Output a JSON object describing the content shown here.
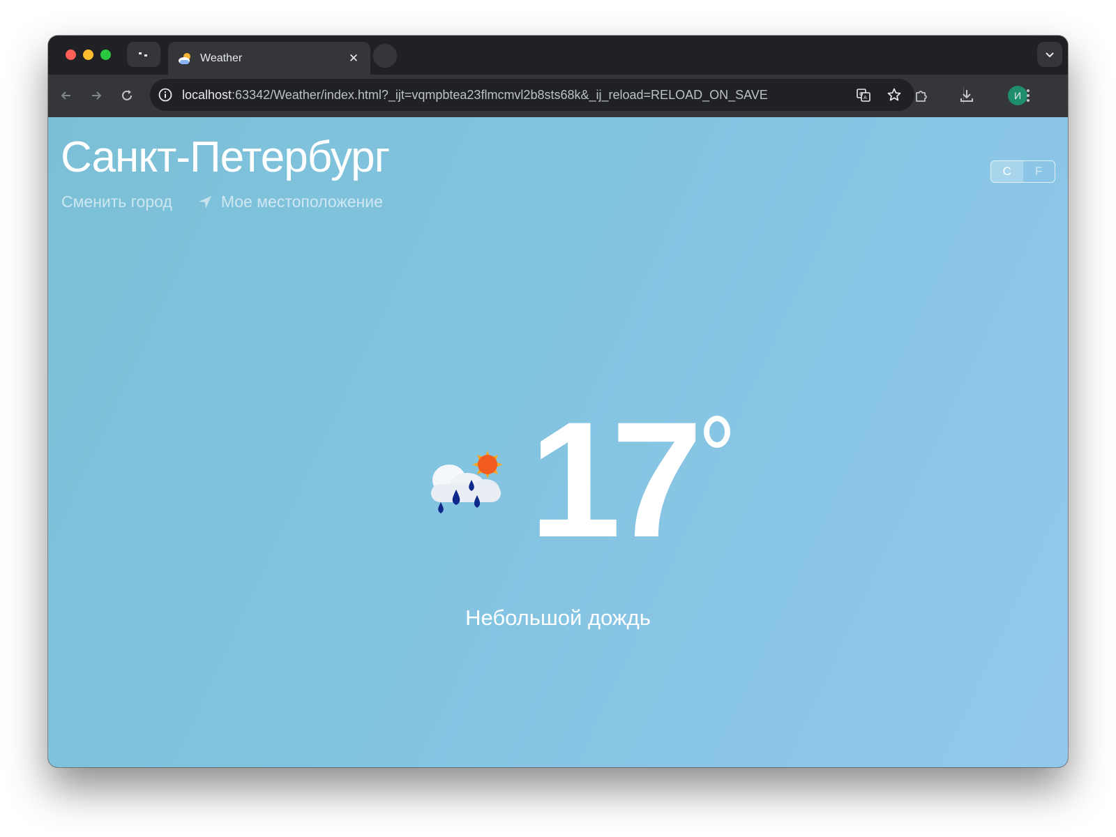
{
  "browser": {
    "tab": {
      "title": "Weather"
    },
    "address": {
      "host": "localhost",
      "path": ":63342/Weather/index.html?_ijt=vqmpbtea23flmcmvl2b8sts68k&_ij_reload=RELOAD_ON_SAVE"
    },
    "profile_initial": "И"
  },
  "weather": {
    "city": "Санкт-Петербург",
    "change_city_label": "Сменить город",
    "my_location_label": "Мое местоположение",
    "units": {
      "c": "C",
      "f": "F",
      "selected": "C"
    },
    "temperature": "17",
    "description": "Небольшой дождь",
    "icon": "cloud-rain-sun-icon"
  }
}
